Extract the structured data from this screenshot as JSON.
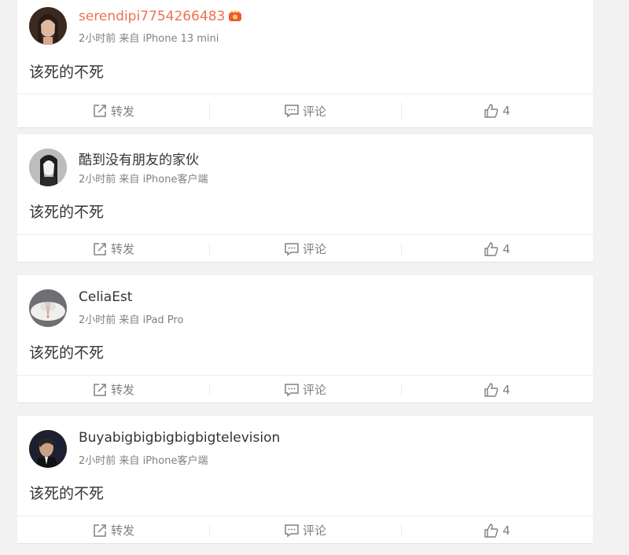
{
  "posts": [
    {
      "username": "serendipi7754266483",
      "vip": true,
      "time": "2小时前",
      "source_prefix": "来自",
      "source": "iPhone 13 mini",
      "content": "该死的不死",
      "repost_label": "转发",
      "comment_label": "评论",
      "like_count": "4"
    },
    {
      "username": "酷到没有朋友的家伙",
      "vip": false,
      "time": "2小时前",
      "source_prefix": "来自",
      "source": "iPhone客户端",
      "content": "该死的不死",
      "repost_label": "转发",
      "comment_label": "评论",
      "like_count": "4"
    },
    {
      "username": "CeliaEst",
      "vip": false,
      "time": "2小时前",
      "source_prefix": "来自",
      "source": "iPad Pro",
      "content": "该死的不死",
      "repost_label": "转发",
      "comment_label": "评论",
      "like_count": "4"
    },
    {
      "username": "Buyabigbigbigbigbigtelevision",
      "vip": false,
      "time": "2小时前",
      "source_prefix": "来自",
      "source": "iPhone客户端",
      "content": "该死的不死",
      "repost_label": "转发",
      "comment_label": "评论",
      "like_count": "4"
    }
  ],
  "colors": {
    "vip_name": "#eb7350",
    "text": "#333333",
    "meta": "#808080",
    "background": "#f2f2f2"
  }
}
